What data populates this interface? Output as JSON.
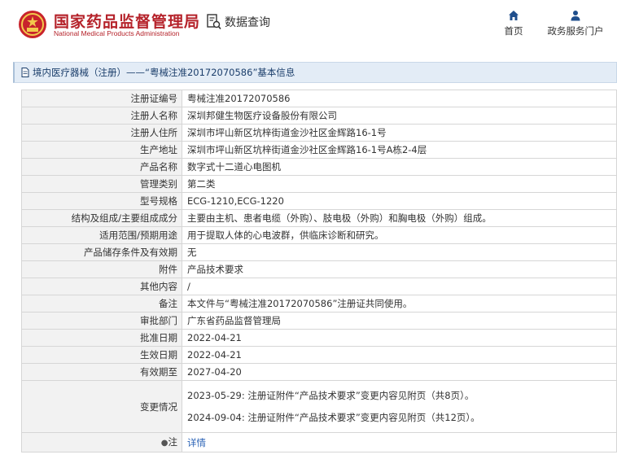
{
  "header": {
    "site_title_cn": "国家药品监督管理局",
    "site_title_en": "National Medical Products Administration",
    "query_label": "数据查询",
    "query_icon": "search-document-icon",
    "nav": [
      {
        "label": "首页",
        "icon": "home-icon"
      },
      {
        "label": "政务服务门户",
        "icon": "user-icon"
      }
    ]
  },
  "page": {
    "title": "境内医疗器械（注册）——“粤械注准20172070586”基本信息"
  },
  "details": [
    {
      "label": "注册证编号",
      "value": "粤械注准20172070586"
    },
    {
      "label": "注册人名称",
      "value": "深圳邦健生物医疗设备股份有限公司"
    },
    {
      "label": "注册人住所",
      "value": "深圳市坪山新区坑梓街道金沙社区金辉路16-1号"
    },
    {
      "label": "生产地址",
      "value": "深圳市坪山新区坑梓街道金沙社区金辉路16-1号A栋2-4层"
    },
    {
      "label": "产品名称",
      "value": "数字式十二道心电图机"
    },
    {
      "label": "管理类别",
      "value": "第二类"
    },
    {
      "label": "型号规格",
      "value": "ECG-1210,ECG-1220"
    },
    {
      "label": "结构及组成/主要组成成分",
      "value": "主要由主机、患者电缆（外购）、肢电极（外购）和胸电极（外购）组成。"
    },
    {
      "label": "适用范围/预期用途",
      "value": "用于提取人体的心电波群，供临床诊断和研究。"
    },
    {
      "label": "产品储存条件及有效期",
      "value": "无"
    },
    {
      "label": "附件",
      "value": "产品技术要求"
    },
    {
      "label": "其他内容",
      "value": "/"
    },
    {
      "label": "备注",
      "value": "本文件与“粤械注准20172070586”注册证共同使用。"
    },
    {
      "label": "审批部门",
      "value": "广东省药品监督管理局"
    },
    {
      "label": "批准日期",
      "value": "2022-04-21"
    },
    {
      "label": "生效日期",
      "value": "2022-04-21"
    },
    {
      "label": "有效期至",
      "value": "2027-04-20"
    }
  ],
  "changes": {
    "label": "变更情况",
    "items": [
      "2023-05-29: 注册证附件“产品技术要求”变更内容见附页（共8页）。",
      "2024-09-04: 注册证附件“产品技术要求”变更内容见附页（共12页）。"
    ]
  },
  "note": {
    "label": "注",
    "icon": "lightbulb-icon",
    "link_text": "详情"
  },
  "colors": {
    "brand_red": "#b5222a",
    "titlebar_bg": "#e3ecf6",
    "label_bg": "#f2f2f2",
    "link": "#2b63b6"
  }
}
